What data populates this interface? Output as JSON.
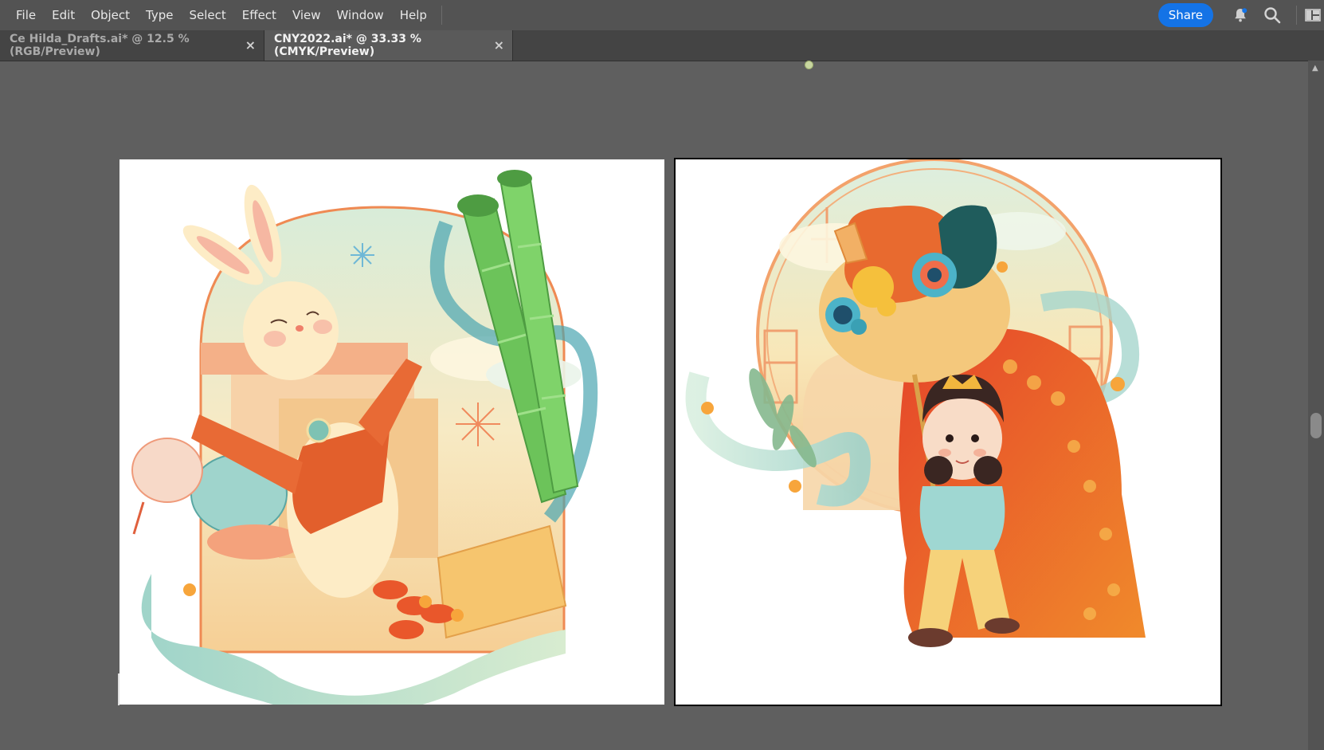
{
  "menu": {
    "items": [
      "File",
      "Edit",
      "Object",
      "Type",
      "Select",
      "Effect",
      "View",
      "Window",
      "Help"
    ]
  },
  "toolbar": {
    "share_label": "Share",
    "icons": [
      "bell-icon",
      "search-icon",
      "panel-layout-icon"
    ]
  },
  "tabs": [
    {
      "label": "Ce Hilda_Drafts.ai* @ 12.5 % (RGB/Preview)",
      "close": "×",
      "active": false
    },
    {
      "label": "CNY2022.ai* @ 33.33 % (CMYK/Preview)",
      "close": "×",
      "active": true
    }
  ],
  "artboards": [
    {
      "name": "rabbit-illustration",
      "subject": "rabbit with lantern, bamboo and firecrackers"
    },
    {
      "name": "lion-dance-illustration",
      "subject": "child performing lion dance"
    }
  ],
  "colors": {
    "accent": "#1473e6",
    "canvas": "#5f5f5f",
    "menubar": "#535353",
    "tabbar": "#444444"
  }
}
